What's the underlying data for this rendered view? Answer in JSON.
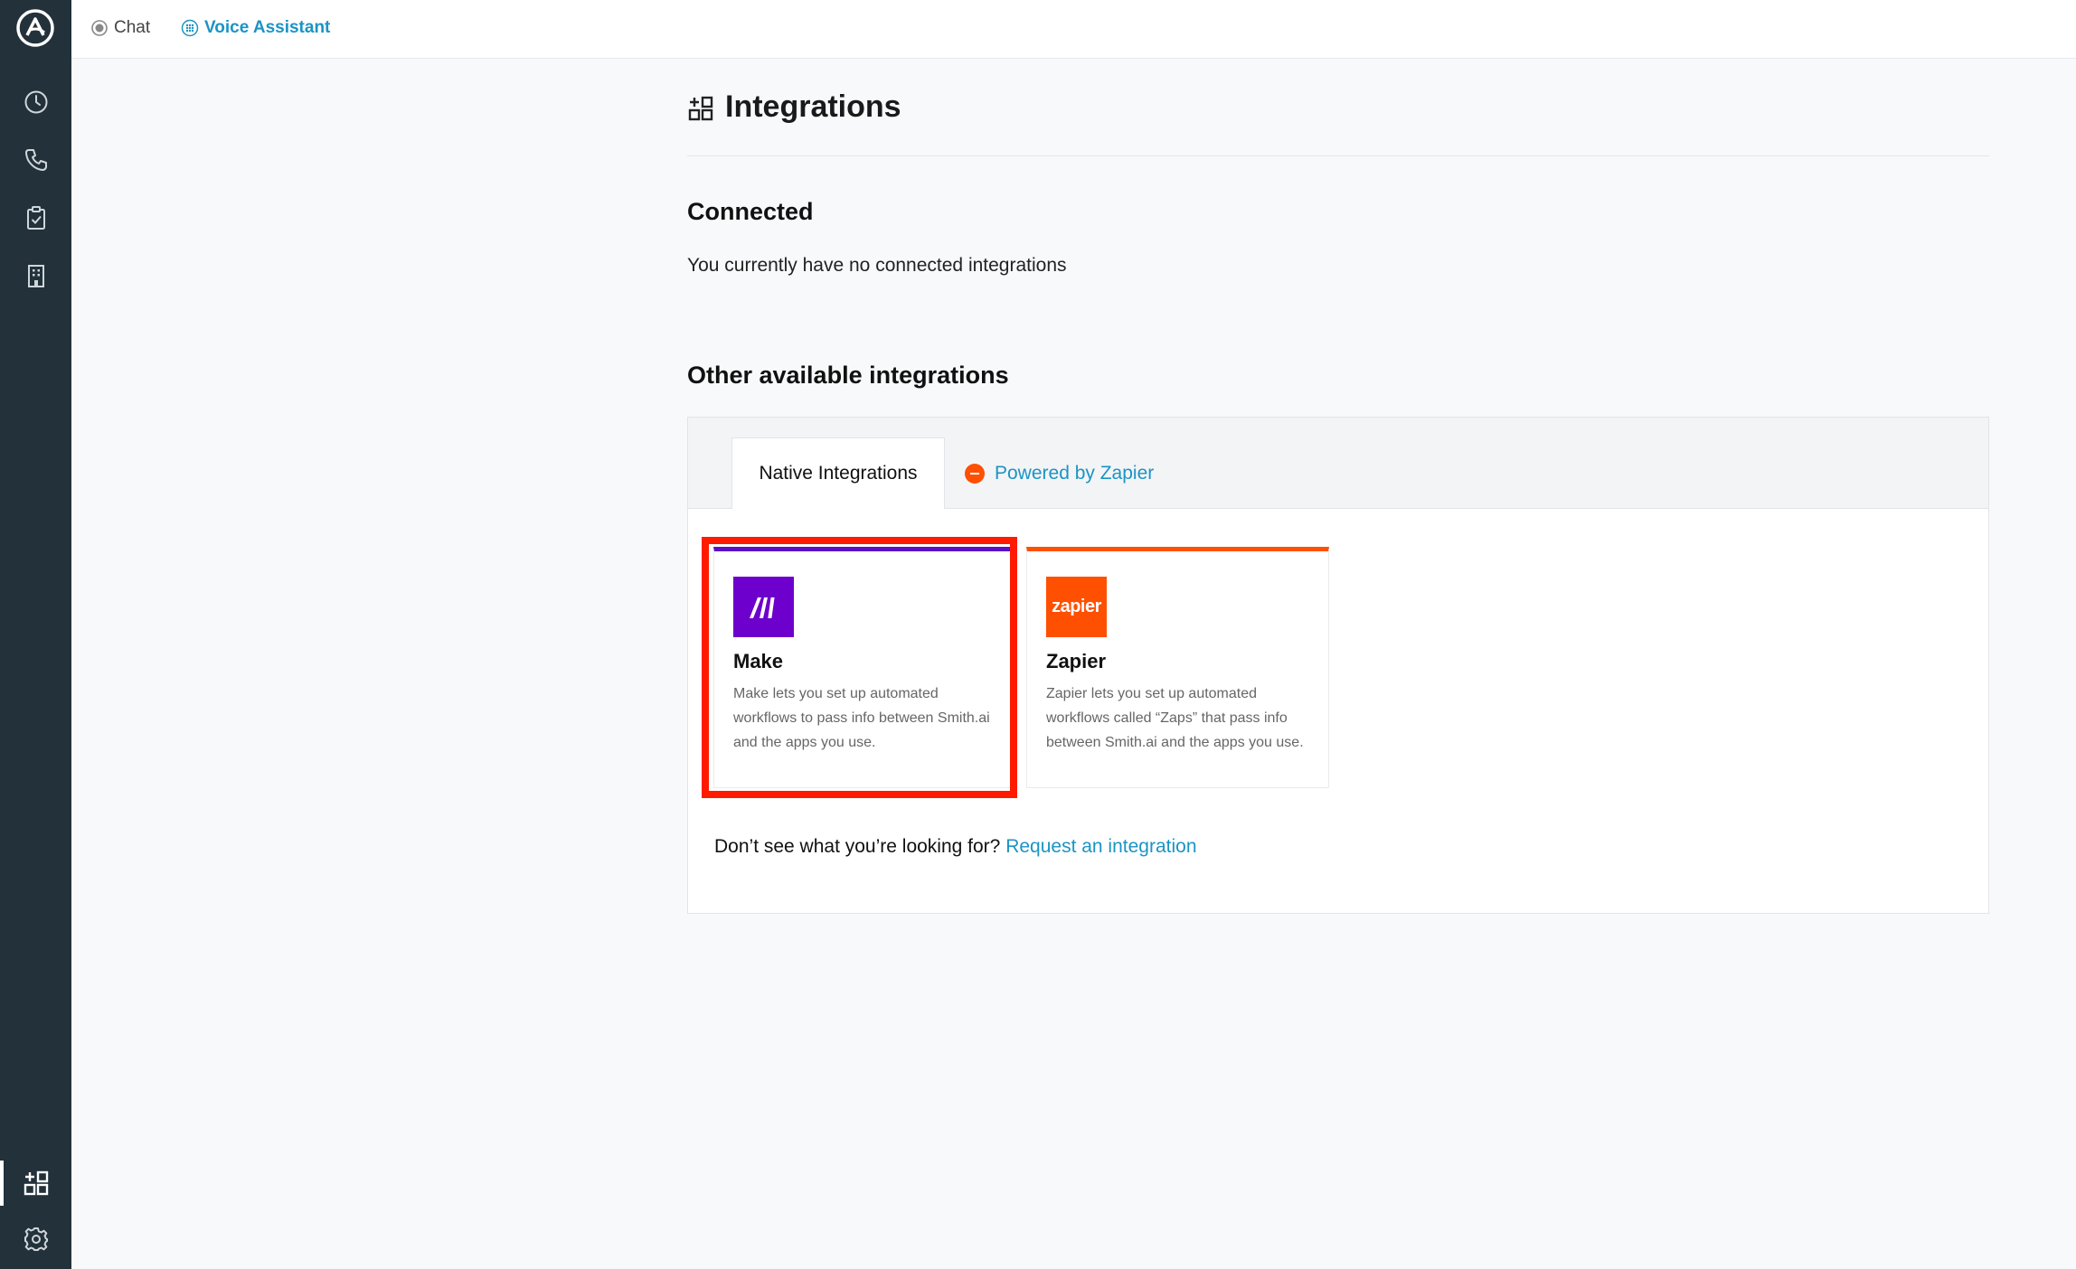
{
  "topbar": {
    "chat_label": "Chat",
    "voice_label": "Voice Assistant"
  },
  "sidebar": {
    "items": [
      {
        "icon": "clock-icon"
      },
      {
        "icon": "phone-icon"
      },
      {
        "icon": "clipboard-check-icon"
      },
      {
        "icon": "building-icon"
      }
    ],
    "bottom_items": [
      {
        "icon": "integrations-grid-icon",
        "active": true
      },
      {
        "icon": "gear-icon"
      }
    ]
  },
  "page": {
    "title": "Integrations",
    "connected": {
      "title": "Connected",
      "text": "You currently have no connected integrations"
    },
    "other": {
      "title": "Other available integrations",
      "tabs": [
        {
          "label": "Native Integrations",
          "active": true
        },
        {
          "label": "Powered by Zapier",
          "active": false
        }
      ],
      "cards": [
        {
          "name": "Make",
          "description": "Make lets you set up automated workflows to pass info between Smith.ai and the apps you use."
        },
        {
          "name": "Zapier",
          "logo_text": "zapier",
          "description": "Zapier lets you set up automated workflows called “Zaps” that pass info between Smith.ai and the apps you use."
        }
      ],
      "request_prefix": "Don’t see what you’re looking for?",
      "request_link": "Request an integration"
    }
  },
  "colors": {
    "sidebar": "#22313a",
    "link": "#1b94c4",
    "make_purple": "#6d00cc",
    "zapier_orange": "#ff4f00",
    "highlight_red": "#ff1a00"
  }
}
